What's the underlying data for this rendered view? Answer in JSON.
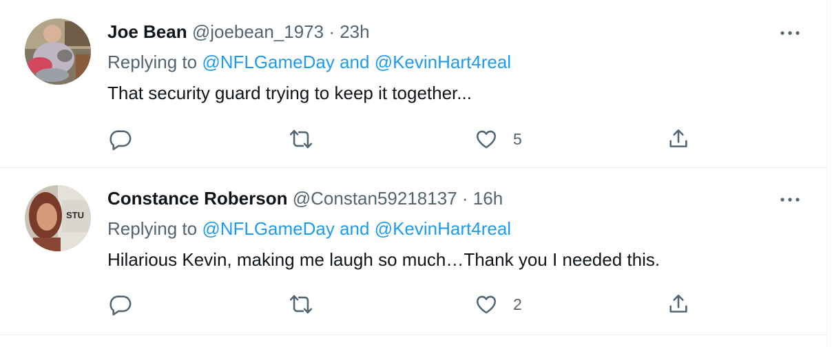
{
  "tweets": [
    {
      "name": "Joe Bean",
      "handle": "@joebean_1973",
      "separator": "·",
      "time": "23h",
      "replying_prefix": "Replying to",
      "replying_to": "@NFLGameDay and @KevinHart4real",
      "text": "That security guard trying to keep it together...",
      "likes": "5",
      "icons": {
        "reply": "reply-icon",
        "retweet": "retweet-icon",
        "like": "heart-icon",
        "share": "share-icon",
        "more": "more-icon"
      }
    },
    {
      "name": "Constance Roberson",
      "handle": "@Constan59218137",
      "separator": "·",
      "time": "16h",
      "replying_prefix": "Replying to",
      "replying_to": "@NFLGameDay and @KevinHart4real",
      "text": "Hilarious Kevin, making me laugh so much…Thank you I needed this.",
      "likes": "2",
      "avatar_badge_text": "STU",
      "icons": {
        "reply": "reply-icon",
        "retweet": "retweet-icon",
        "like": "heart-icon",
        "share": "share-icon",
        "more": "more-icon"
      }
    }
  ],
  "colors": {
    "link": "#1d9bf0",
    "secondary_text": "#536471",
    "primary_text": "#0f1419",
    "divider": "#eff3f4"
  }
}
